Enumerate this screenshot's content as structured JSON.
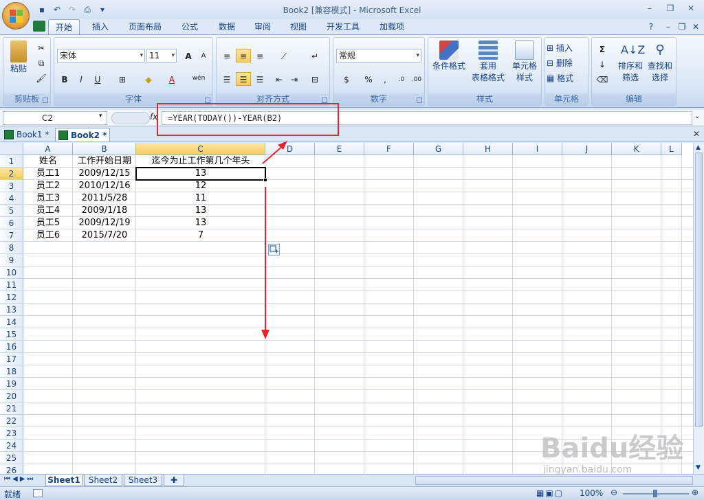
{
  "window": {
    "title": "Book2  [兼容模式] - Microsoft Excel"
  },
  "tabs": [
    "开始",
    "插入",
    "页面布局",
    "公式",
    "数据",
    "审阅",
    "视图",
    "开发工具",
    "加载项"
  ],
  "ribbon": {
    "clipboard": {
      "paste": "粘贴",
      "label": "剪贴板"
    },
    "font": {
      "name": "宋体",
      "size": "11",
      "label": "字体",
      "bold": "B",
      "italic": "I",
      "underline": "U",
      "grow": "A",
      "shrink": "A",
      "fontcolor": "A",
      "phonetic": "wén"
    },
    "alignment": {
      "label": "对齐方式"
    },
    "number": {
      "format": "常规",
      "label": "数字",
      "percent": "%",
      "comma": ","
    },
    "styles": {
      "conditional": "条件格式",
      "table1": "套用",
      "table2": "表格格式",
      "cell1": "单元格",
      "cell2": "样式",
      "label": "样式"
    },
    "cells": {
      "insert": "插入",
      "delete": "删除",
      "format": "格式",
      "label": "单元格"
    },
    "editing": {
      "sort1": "排序和",
      "sort2": "筛选",
      "find1": "查找和",
      "find2": "选择",
      "label": "编辑",
      "sum": "Σ"
    }
  },
  "formula_bar": {
    "name_box": "C2",
    "fx": "fx",
    "formula": "=YEAR(TODAY())-YEAR(B2)"
  },
  "workbooks": [
    "Book1 *",
    "Book2 *"
  ],
  "columns": [
    "A",
    "B",
    "C",
    "D",
    "E",
    "F",
    "G",
    "H",
    "I",
    "J",
    "K",
    "L"
  ],
  "rows": [
    "1",
    "2",
    "3",
    "4",
    "5",
    "6",
    "7",
    "8",
    "9",
    "10",
    "11",
    "12",
    "13",
    "14",
    "15",
    "16",
    "17",
    "18",
    "19",
    "20",
    "21",
    "22",
    "23",
    "24",
    "25",
    "26"
  ],
  "cells": {
    "headers": [
      "姓名",
      "工作开始日期",
      "迄今为止工作第几个年头"
    ],
    "data": [
      [
        "员工1",
        "2009/12/15",
        "13"
      ],
      [
        "员工2",
        "2010/12/16",
        "12"
      ],
      [
        "员工3",
        "2011/5/28",
        "11"
      ],
      [
        "员工4",
        "2009/1/18",
        "13"
      ],
      [
        "员工5",
        "2009/12/19",
        "13"
      ],
      [
        "员工6",
        "2015/7/20",
        "7"
      ]
    ]
  },
  "sheets": [
    "Sheet1",
    "Sheet2",
    "Sheet3"
  ],
  "status": {
    "ready": "就绪",
    "zoom": "100%"
  },
  "watermark": {
    "brand": "Baidu经验",
    "url": "jingyan.baidu.com"
  },
  "colors": {
    "accent": "#e8232b",
    "select": "#f7c95e",
    "ribbon": "#dbe7f6"
  }
}
